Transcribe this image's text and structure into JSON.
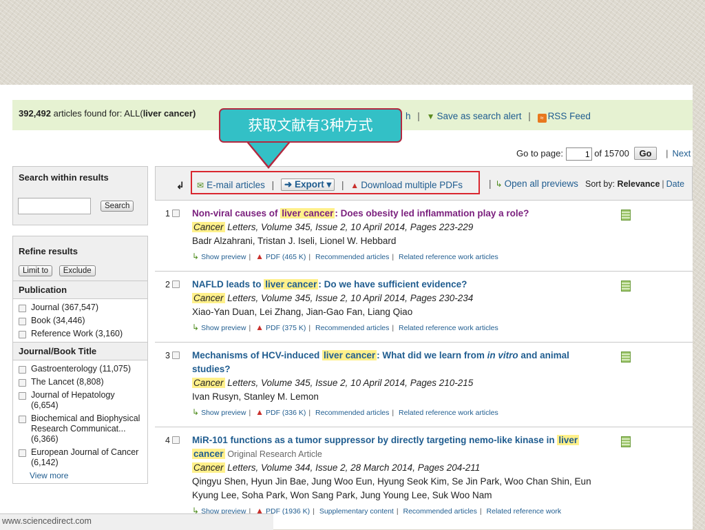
{
  "header": {
    "count": "392,492",
    "found_text": " articles found for: ALL(",
    "query": "liver cancer",
    "close_paren": ")",
    "partial_link": "h",
    "save_alert": "Save as search alert",
    "rss_feed": "RSS Feed"
  },
  "callout": {
    "text": "获取文献有3种方式"
  },
  "pagination": {
    "label": "Go to page:",
    "current": "1",
    "of_total": "of 15700",
    "go": "Go",
    "next": "Next"
  },
  "sidebar": {
    "search_title": "Search within results",
    "search_button": "Search",
    "refine_title": "Refine results",
    "limit_to": "Limit to",
    "exclude": "Exclude",
    "publication_title": "Publication",
    "publication_items": [
      "Journal (367,547)",
      "Book (34,446)",
      "Reference Work (3,160)"
    ],
    "journal_title": "Journal/Book Title",
    "journal_items": [
      "Gastroenterology (11,075)",
      "The Lancet (8,808)",
      "Journal of Hepatology (6,654)",
      "Biochemical and Biophysical Research Communicat... (6,366)",
      "European Journal of Cancer (6,142)"
    ],
    "view_more": "View more"
  },
  "toolbar": {
    "email": "E-mail articles",
    "export": "Export",
    "download_pdfs": "Download multiple PDFs",
    "open_previews": "Open all previews",
    "sort_label": "Sort by: ",
    "sort_relevance": "Relevance",
    "sort_date": "Date"
  },
  "results": [
    {
      "num": "1",
      "title_pre": "Non-viral causes of ",
      "title_hl": "liver cancer",
      "title_post": ": Does obesity led inflammation play a role?",
      "source_journal": "Cancer",
      "source_rest": " Letters, Volume 345, Issue 2, 10 April 2014, Pages 223-229",
      "authors": "Badr Alzahrani, Tristan J. Iseli, Lionel W. Hebbard",
      "show_preview": "Show preview",
      "pdf": "PDF (465 K)",
      "recommended": "Recommended articles",
      "related": "Related reference work articles"
    },
    {
      "num": "2",
      "title_pre": "NAFLD leads to ",
      "title_hl": "liver cancer",
      "title_post": ": Do we have sufficient evidence?",
      "source_journal": "Cancer",
      "source_rest": " Letters, Volume 345, Issue 2, 10 April 2014, Pages 230-234",
      "authors": "Xiao-Yan Duan, Lei Zhang, Jian-Gao Fan, Liang Qiao",
      "show_preview": "Show preview",
      "pdf": "PDF (375 K)",
      "recommended": "Recommended articles",
      "related": "Related reference work articles"
    },
    {
      "num": "3",
      "title_pre": "Mechanisms of HCV-induced ",
      "title_hl": "liver cancer",
      "title_mid": ": What did we learn from ",
      "title_italic": "in vitro",
      "title_post": " and animal studies?",
      "source_journal": "Cancer",
      "source_rest": " Letters, Volume 345, Issue 2, 10 April 2014, Pages 210-215",
      "authors": "Ivan Rusyn, Stanley M. Lemon",
      "show_preview": "Show preview",
      "pdf": "PDF (336 K)",
      "recommended": "Recommended articles",
      "related": "Related reference work articles"
    },
    {
      "num": "4",
      "title_pre": "MiR-101 functions as a tumor suppressor by directly targeting nemo-like kinase in ",
      "title_hl": "liver",
      "title_hl2": "cancer",
      "article_type": "Original Research Article",
      "source_journal": "Cancer",
      "source_rest": " Letters, Volume 344, Issue 2, 28 March 2014, Pages 204-211",
      "authors": "Qingyu Shen, Hyun Jin Bae, Jung Woo Eun, Hyung Seok Kim, Se Jin Park, Woo Chan Shin, Eun Kyung Lee, Soha Park, Won Sang Park, Jung Young Lee, Suk Woo Nam",
      "show_preview": "Show preview",
      "pdf": "PDF (1936 K)",
      "supplementary": "Supplementary content",
      "recommended": "Recommended articles",
      "related": "Related reference work"
    }
  ],
  "footer": {
    "url": "www.sciencedirect.com"
  }
}
